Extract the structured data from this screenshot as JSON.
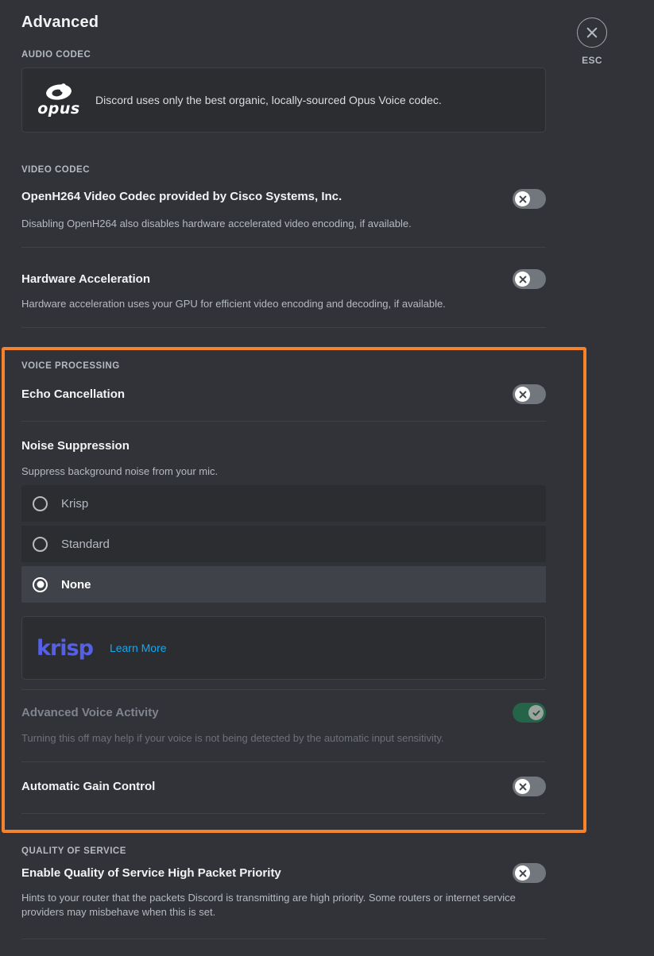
{
  "header": {
    "title": "Advanced",
    "close_label": "ESC",
    "close_icon": "close-x-icon"
  },
  "audio_codec": {
    "section_label": "AUDIO CODEC",
    "logo_text": "opus",
    "logo_icon": "opus-logo-icon",
    "description": "Discord uses only the best organic, locally-sourced Opus Voice codec."
  },
  "video_codec": {
    "section_label": "VIDEO CODEC",
    "items": [
      {
        "title": "OpenH264 Video Codec provided by Cisco Systems, Inc.",
        "description": "Disabling OpenH264 also disables hardware accelerated video encoding, if available.",
        "toggle_state": "off"
      },
      {
        "title": "Hardware Acceleration",
        "description": "Hardware acceleration uses your GPU for efficient video encoding and decoding, if available.",
        "toggle_state": "off"
      }
    ]
  },
  "voice_processing": {
    "section_label": "VOICE PROCESSING",
    "echo_cancellation": {
      "title": "Echo Cancellation",
      "toggle_state": "off"
    },
    "noise_suppression": {
      "title": "Noise Suppression",
      "description": "Suppress background noise from your mic.",
      "options": [
        {
          "label": "Krisp",
          "selected": false
        },
        {
          "label": "Standard",
          "selected": false
        },
        {
          "label": "None",
          "selected": true
        }
      ]
    },
    "krisp_promo": {
      "logo_text": "krisp",
      "link_label": "Learn More"
    },
    "advanced_voice_activity": {
      "title": "Advanced Voice Activity",
      "description": "Turning this off may help if your voice is not being detected by the automatic input sensitivity.",
      "toggle_state": "on",
      "disabled": true
    },
    "automatic_gain_control": {
      "title": "Automatic Gain Control",
      "toggle_state": "off"
    }
  },
  "quality_of_service": {
    "section_label": "QUALITY OF SERVICE",
    "title": "Enable Quality of Service High Packet Priority",
    "description": "Hints to your router that the packets Discord is transmitting are high priority. Some routers or internet service providers may misbehave when this is set.",
    "toggle_state": "off"
  },
  "colors": {
    "background": "#313338",
    "card": "#2b2d31",
    "divider": "#3f4147",
    "highlight_border": "#f5832d",
    "toggle_off": "#72767d",
    "toggle_on": "#246449",
    "krisp_purple": "#5560e6",
    "link_blue": "#12a9f5"
  }
}
